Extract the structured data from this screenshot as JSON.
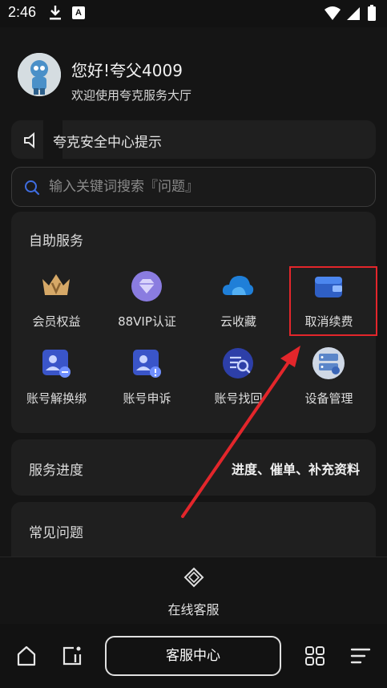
{
  "status_bar": {
    "time": "2:46",
    "a_badge": "A"
  },
  "profile": {
    "greeting": "您好!夸父4009",
    "welcome": "欢迎使用夸克服务大厅"
  },
  "notice": {
    "text": "夸克安全中心提示"
  },
  "search": {
    "placeholder": "输入关键词搜索『问题』"
  },
  "self_service": {
    "title": "自助服务",
    "items": [
      {
        "label": "会员权益",
        "icon": "crown-icon"
      },
      {
        "label": "88VIP认证",
        "icon": "diamond-icon"
      },
      {
        "label": "云收藏",
        "icon": "cloud-icon"
      },
      {
        "label": "取消续费",
        "icon": "wallet-icon"
      },
      {
        "label": "账号解换绑",
        "icon": "account-unbind-icon"
      },
      {
        "label": "账号申诉",
        "icon": "account-appeal-icon"
      },
      {
        "label": "账号找回",
        "icon": "account-recover-icon"
      },
      {
        "label": "设备管理",
        "icon": "device-manage-icon"
      }
    ]
  },
  "progress": {
    "label": "服务进度",
    "value": "进度、催单、补充资料"
  },
  "faq": {
    "label": "常见问题"
  },
  "online_service": {
    "label": "在线客服"
  },
  "bottom_nav": {
    "center_label": "客服中心"
  },
  "colors": {
    "highlight": "#e3262b",
    "background": "#151515",
    "card": "#1f1f1f",
    "accent_blue": "#3f6de0"
  }
}
